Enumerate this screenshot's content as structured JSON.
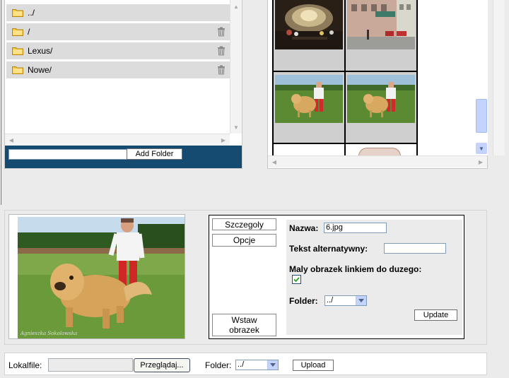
{
  "folders": {
    "items": [
      {
        "name": "../",
        "deletable": false
      },
      {
        "name": "/",
        "deletable": true
      },
      {
        "name": "Lexus/",
        "deletable": true
      },
      {
        "name": "Nowe/",
        "deletable": true
      }
    ],
    "new_folder_value": "",
    "add_folder_label": "Add Folder"
  },
  "thumbnails": [
    {
      "name": "night-fountain-thumb"
    },
    {
      "name": "city-street-thumb"
    },
    {
      "name": "man-with-dog-thumb-1"
    },
    {
      "name": "man-with-dog-thumb-2"
    },
    {
      "name": "blank-thumb"
    },
    {
      "name": "stamp-thumb"
    }
  ],
  "preview": {
    "watermark": "Agnieszka Sokolowska"
  },
  "tabs": {
    "details": "Szczegoly",
    "options": "Opcje",
    "insert": "Wstaw obrazek"
  },
  "form": {
    "name_label": "Nazwa:",
    "name_value": "6.jpg",
    "alt_label": "Tekst alternatywny:",
    "alt_value": "",
    "link_label": "Maly obrazek linkiem do duzego:",
    "link_checked": true,
    "folder_label": "Folder:",
    "folder_value": "../",
    "update_label": "Update"
  },
  "upload": {
    "localfile_label": "Lokalfile:",
    "localfile_value": "",
    "browse_label": "Przeglądaj...",
    "folder_label": "Folder:",
    "folder_value": "../",
    "upload_label": "Upload"
  },
  "colors": {
    "folder_bar": "#154b70",
    "row_bg": "#dcdcdc",
    "folder_icon": "#f0c419",
    "page_bg": "#ebebeb"
  }
}
